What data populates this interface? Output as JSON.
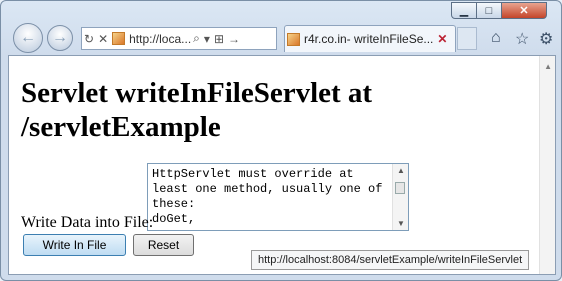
{
  "window": {
    "minimize_glyph": "▁",
    "maximize_glyph": "□",
    "close_glyph": "✕"
  },
  "toolbar": {
    "back_glyph": "←",
    "forward_glyph": "→",
    "address": "http://loca...",
    "refresh_glyph": "↻",
    "stop_glyph": "✕",
    "search_glyph": "⌕",
    "dropdown_glyph": "▾",
    "compat_glyph": "⊞",
    "go_glyph": "→"
  },
  "tab": {
    "title": "r4r.co.in- writeInFileSe...",
    "close_glyph": "✕"
  },
  "icons": {
    "home": "⌂",
    "favorites": "☆",
    "tools": "⚙"
  },
  "page": {
    "heading": "Servlet writeInFileServlet at /servletExample",
    "write_label": "Write Data into File:",
    "textarea_value": "HttpServlet must override at least one method, usually one of these:\ndoGet,",
    "write_button": "Write In File",
    "reset_button": "Reset"
  },
  "status": {
    "url": "http://localhost:8084/servletExample/writeInFileServlet"
  },
  "scroll": {
    "up_glyph": "▲",
    "down_glyph": "▼"
  }
}
